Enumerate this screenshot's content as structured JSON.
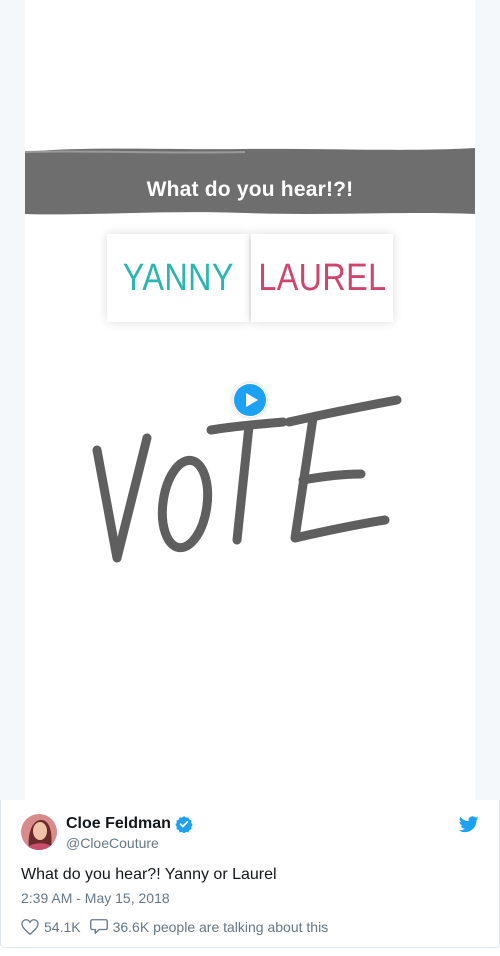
{
  "video": {
    "banner_text": "What do you hear!?!",
    "option_left": "YANNY",
    "option_right": "LAUREL",
    "handwritten_word": "VOTE",
    "icons": {
      "play": "play-icon",
      "info": "info-icon"
    }
  },
  "tweet": {
    "author_name": "Cloe Feldman",
    "handle": "@CloeCouture",
    "text": "What do you hear?! Yanny or Laurel",
    "timestamp": "2:39 AM - May 15, 2018",
    "likes": "54.1K",
    "talking": "36.6K people are talking about this",
    "icons": {
      "verified": "verified-badge-icon",
      "brand": "twitter-bird-icon",
      "like": "heart-icon",
      "reply": "speech-bubble-icon"
    }
  },
  "colors": {
    "yanny": "#2bb5b0",
    "laurel": "#d0456b",
    "twitter_blue": "#1da1f2",
    "muted_text": "#657786",
    "banner_gray": "#6e6e6e"
  }
}
